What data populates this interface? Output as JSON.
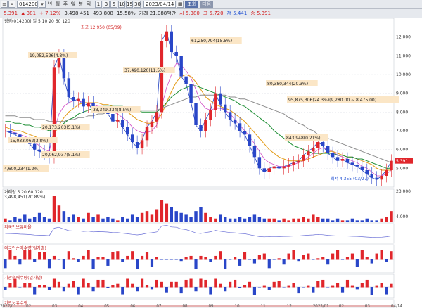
{
  "toolbar": {
    "symbol_code": "014200",
    "indicator_buttons": [
      "년",
      "월",
      "주",
      "일",
      "분",
      "틱"
    ],
    "nav_icons": [
      "◀",
      "▶"
    ],
    "quote": [
      {
        "label": "",
        "value": "5,391",
        "color": "#d21f1f"
      },
      {
        "label": "▲",
        "value": "381",
        "color": "#d21f1f"
      },
      {
        "label": "+",
        "value": "7.12%",
        "color": "#d21f1f"
      },
      {
        "label": "",
        "value": "3,498,451",
        "color": "#222222"
      },
      {
        "label": "",
        "value": "493,808",
        "color": "#222222"
      },
      {
        "label": "",
        "value": "15.58%",
        "color": "#222222"
      }
    ],
    "prices": [
      {
        "label": "거래",
        "value": "21,088백만",
        "color": "#222222"
      },
      {
        "label": "시",
        "value": "5,380",
        "color": "#d21f1f"
      },
      {
        "label": "고",
        "value": "5,720",
        "color": "#d21f1f"
      },
      {
        "label": "저",
        "value": "5,441",
        "color": "#1f4fd2"
      },
      {
        "label": "종",
        "value": "5,391",
        "color": "#d21f1f"
      }
    ],
    "periods": [
      "1",
      "3",
      "5",
      "10",
      "15",
      "30"
    ],
    "date_value": "2023/04/14",
    "search_button": "조회",
    "next_button": "다음"
  },
  "main_legend": "광림(014200) 일 5 10 20 60 120",
  "high_label": "최고 12,950 (05/09)",
  "low_label": "최저 4,355 (03/27)",
  "annotations": [
    "61,250,794(15.5%)",
    "19,052,526(4.8%)",
    "37,490,120(11.5%)",
    "80,380,344(20.3%)",
    "95,875,306(24.3%)(9,280.00 ~ 8,475.00)",
    "33,349,334(8.5%)",
    "20,173,203(5.1%)",
    "15,033,062(3.8%)",
    "20,062,937(5.1%)",
    "4,600,234(1.2%)",
    "843,948(0.21%)"
  ],
  "price_ticks": [
    "12,000",
    "11,000",
    "10,000",
    "9,000",
    "8,000",
    "7,000",
    "6,000",
    "5,000"
  ],
  "price_tag": "5,391",
  "volume_legend": "거래량 5 20 60 120",
  "volume_value": "3,498,451(7C 89%)",
  "volume_ticks": [
    "23,000",
    "",
    "",
    "4,000"
  ],
  "panel_titles": [
    "외국인보유비율",
    "외국인순매수량(일자별)",
    "기관순매수량(일자별)",
    "기관보유수량"
  ],
  "date_ticks": [
    "2022/01",
    "02",
    "03",
    "04",
    "05",
    "06",
    "07",
    "08",
    "09",
    "10",
    "11",
    "12",
    "2023/01",
    "02",
    "03",
    "04/14"
  ],
  "chart_data": {
    "type": "line",
    "x": [
      0,
      1,
      2,
      3,
      4,
      5,
      6,
      7,
      8,
      9,
      10,
      11,
      12,
      13,
      14,
      15,
      16,
      17,
      18,
      19,
      20,
      21,
      22,
      23,
      24,
      25,
      26,
      27,
      28,
      29,
      30,
      31,
      32,
      33,
      34,
      35,
      36,
      37,
      38,
      39,
      40,
      41,
      42,
      43,
      44,
      45,
      46,
      47,
      48,
      49,
      50,
      51,
      52,
      53,
      54,
      55,
      56,
      57,
      58,
      59,
      60,
      61,
      62,
      63,
      64,
      65,
      66,
      67,
      68,
      69,
      70,
      71,
      72,
      73,
      74,
      75,
      76,
      77,
      78,
      79
    ],
    "series": [
      {
        "values": [
          7.0,
          6.9,
          6.8,
          6.6,
          6.5,
          6.3,
          6.0,
          5.9,
          5.8,
          5.6,
          10.4,
          11.0,
          9.8,
          8.8,
          8.6,
          8.7,
          8.3,
          8.5,
          8.0,
          8.2,
          8.1,
          7.9,
          7.5,
          7.6,
          7.2,
          6.8,
          6.4,
          6.1,
          6.5,
          7.2,
          7.5,
          8.0,
          11.8,
          12.3,
          11.2,
          11.0,
          9.9,
          9.5,
          8.5,
          7.3,
          7.0,
          7.6,
          8.1,
          9.0,
          8.4,
          8.0,
          7.6,
          7.4,
          7.0,
          6.8,
          6.2,
          5.6,
          5.0,
          4.8,
          5.0,
          5.1,
          5.0,
          5.1,
          5.2,
          5.3,
          5.4,
          5.7,
          5.9,
          6.1,
          6.4,
          6.2,
          5.8,
          5.6,
          5.4,
          5.5,
          5.3,
          5.2,
          5.1,
          4.9,
          4.7,
          4.5,
          4.4,
          4.6,
          4.9,
          5.4
        ]
      },
      {
        "values": [
          7.0,
          6.95,
          6.9,
          6.8,
          6.7,
          6.6,
          6.4,
          6.2,
          6.0,
          5.9,
          7.0,
          7.9,
          8.3,
          8.5,
          8.6,
          8.6,
          8.5,
          8.5,
          8.4,
          8.3,
          8.3,
          8.2,
          8.0,
          7.9,
          7.7,
          7.5,
          7.2,
          7.0,
          6.9,
          6.9,
          7.0,
          7.3,
          8.3,
          9.3,
          10.0,
          10.6,
          10.5,
          10.2,
          9.8,
          9.2,
          8.5,
          8.2,
          8.1,
          8.2,
          8.2,
          8.1,
          7.9,
          7.6,
          7.3,
          7.0,
          6.7,
          6.3,
          5.9,
          5.5,
          5.3,
          5.2,
          5.1,
          5.1,
          5.1,
          5.2,
          5.3,
          5.4,
          5.6,
          5.8,
          6.0,
          6.1,
          6.0,
          5.9,
          5.7,
          5.6,
          5.5,
          5.4,
          5.3,
          5.1,
          5.0,
          4.8,
          4.6,
          4.6,
          4.7,
          4.9
        ]
      },
      {
        "values": [
          7.2,
          7.1,
          7.0,
          7.0,
          6.9,
          6.8,
          6.7,
          6.6,
          6.5,
          6.4,
          6.8,
          7.3,
          7.7,
          8.0,
          8.2,
          8.4,
          8.5,
          8.5,
          8.5,
          8.5,
          8.4,
          8.4,
          8.3,
          8.2,
          8.1,
          8.0,
          7.8,
          7.6,
          7.5,
          7.4,
          7.4,
          7.5,
          7.9,
          8.5,
          9.1,
          9.6,
          9.9,
          10.0,
          9.9,
          9.6,
          9.2,
          8.8,
          8.6,
          8.4,
          8.3,
          8.2,
          8.1,
          7.9,
          7.7,
          7.5,
          7.2,
          6.9,
          6.6,
          6.3,
          6.0,
          5.8,
          5.6,
          5.5,
          5.4,
          5.4,
          5.4,
          5.4,
          5.5,
          5.6,
          5.7,
          5.8,
          5.9,
          5.9,
          5.8,
          5.7,
          5.6,
          5.6,
          5.5,
          5.4,
          5.3,
          5.2,
          5.0,
          4.9,
          4.9,
          4.9
        ]
      },
      {
        "values": [
          7.5,
          7.5,
          7.4,
          7.4,
          7.3,
          7.3,
          7.2,
          7.2,
          7.1,
          7.0,
          7.1,
          7.2,
          7.4,
          7.6,
          7.7,
          7.9,
          8.0,
          8.1,
          8.2,
          8.2,
          8.3,
          8.3,
          8.3,
          8.3,
          8.3,
          8.2,
          8.2,
          8.1,
          8.0,
          8.0,
          8.0,
          8.0,
          8.2,
          8.5,
          8.8,
          9.0,
          9.2,
          9.3,
          9.4,
          9.4,
          9.3,
          9.2,
          9.1,
          9.0,
          8.9,
          8.8,
          8.7,
          8.6,
          8.4,
          8.3,
          8.1,
          7.9,
          7.7,
          7.5,
          7.3,
          7.0,
          6.8,
          6.6,
          6.4,
          6.2,
          6.1,
          6.0,
          5.9,
          5.8,
          5.8,
          5.8,
          5.8,
          5.8,
          5.7,
          5.7,
          5.6,
          5.6,
          5.5,
          5.5,
          5.4,
          5.3,
          5.2,
          5.1,
          5.0,
          5.0
        ]
      },
      {
        "values": [
          7.8,
          7.8,
          7.8,
          7.7,
          7.7,
          7.7,
          7.6,
          7.6,
          7.6,
          7.5,
          7.5,
          7.5,
          7.5,
          7.6,
          7.6,
          7.7,
          7.7,
          7.8,
          7.8,
          7.9,
          7.9,
          8.0,
          8.0,
          8.0,
          8.1,
          8.1,
          8.1,
          8.1,
          8.1,
          8.1,
          8.1,
          8.1,
          8.2,
          8.3,
          8.4,
          8.5,
          8.6,
          8.7,
          8.8,
          8.8,
          8.9,
          8.9,
          8.9,
          8.9,
          8.9,
          8.9,
          8.8,
          8.8,
          8.7,
          8.7,
          8.6,
          8.5,
          8.4,
          8.3,
          8.2,
          8.1,
          8.0,
          7.9,
          7.7,
          7.6,
          7.4,
          7.3,
          7.1,
          7.0,
          6.8,
          6.7,
          6.6,
          6.5,
          6.4,
          6.3,
          6.2,
          6.1,
          6.0,
          5.9,
          5.8,
          5.7,
          5.6,
          5.5,
          5.4,
          5.3
        ]
      }
    ],
    "volume": [
      2,
      1,
      3,
      2,
      4,
      2,
      3,
      5,
      3,
      2,
      14,
      9,
      6,
      3,
      4,
      3,
      2,
      5,
      3,
      4,
      2,
      3,
      2,
      1,
      3,
      2,
      4,
      3,
      5,
      6,
      4,
      7,
      12,
      10,
      8,
      6,
      5,
      4,
      3,
      6,
      8,
      5,
      3,
      2,
      4,
      3,
      2,
      2,
      3,
      2,
      3,
      4,
      3,
      2,
      2,
      2,
      1,
      2,
      1,
      2,
      2,
      3,
      2,
      4,
      3,
      2,
      2,
      1,
      2,
      1,
      1,
      2,
      1,
      1,
      2,
      1,
      1,
      2,
      3,
      6
    ],
    "ylim": [
      4,
      13
    ]
  },
  "colors": {
    "up": "#e0262b",
    "down": "#2946c8",
    "ma5": "#1f3fbf",
    "ma10": "#d14ec6",
    "ma20": "#e39a13",
    "ma60": "#1d8f34",
    "ma120": "#8c8c8c",
    "label_bg": "#fbe6c6"
  }
}
